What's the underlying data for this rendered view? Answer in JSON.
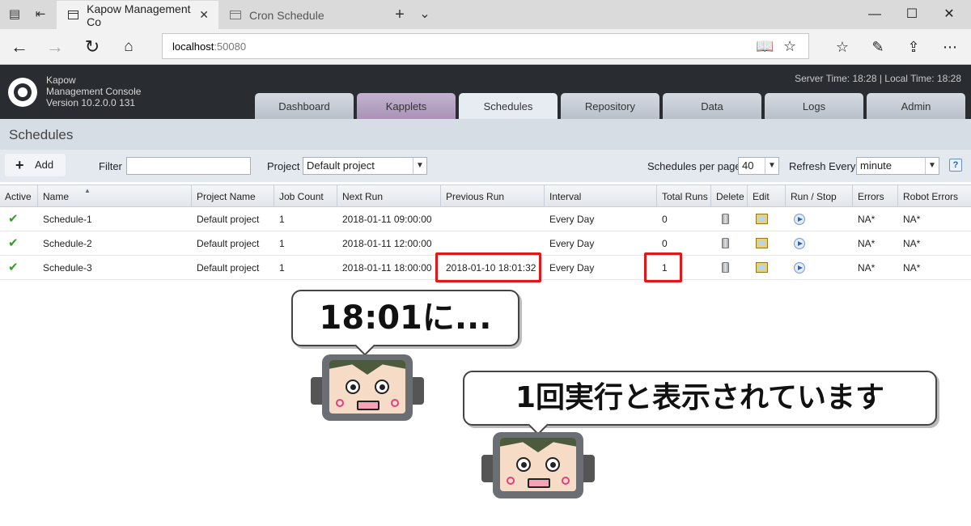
{
  "browser": {
    "tabs": [
      {
        "title": "Kapow Management Co",
        "active": true
      },
      {
        "title": "Cron Schedule",
        "active": false
      }
    ],
    "new_tab": "+",
    "tab_menu": "⌄",
    "url_host": "localhost",
    "url_port": ":50080"
  },
  "app": {
    "brand_line1": "Kapow",
    "brand_line2": "Management Console",
    "brand_line3": "Version 10.2.0.0 131",
    "server_time": "Server Time: 18:28  |  Local Time: 18:28",
    "tabs": [
      "Dashboard",
      "Kapplets",
      "Schedules",
      "Repository",
      "Data",
      "Logs",
      "Admin"
    ],
    "active_tab": "Schedules"
  },
  "schedules": {
    "title": "Schedules",
    "add_label": "Add",
    "filter_label": "Filter",
    "filter_value": "",
    "project_label": "Project",
    "project_value": "Default project",
    "per_page_label": "Schedules per page",
    "per_page_value": "40",
    "refresh_label": "Refresh Every",
    "refresh_value": "minute",
    "help": "?",
    "columns": [
      "Active",
      "Name",
      "Project Name",
      "Job Count",
      "Next Run",
      "Previous Run",
      "Interval",
      "Total Runs",
      "Delete",
      "Edit",
      "Run / Stop",
      "Errors",
      "Robot Errors"
    ],
    "rows": [
      {
        "name": "Schedule-1",
        "project": "Default project",
        "job_count": "1",
        "next_run": "2018-01-11 09:00:00",
        "previous_run": "",
        "interval": "Every Day",
        "total_runs": "0",
        "errors": "NA*",
        "robot_errors": "NA*"
      },
      {
        "name": "Schedule-2",
        "project": "Default project",
        "job_count": "1",
        "next_run": "2018-01-11 12:00:00",
        "previous_run": "",
        "interval": "Every Day",
        "total_runs": "0",
        "errors": "NA*",
        "robot_errors": "NA*"
      },
      {
        "name": "Schedule-3",
        "project": "Default project",
        "job_count": "1",
        "next_run": "2018-01-11 18:00:00",
        "previous_run": "2018-01-10 18:01:32",
        "interval": "Every Day",
        "total_runs": "1",
        "errors": "NA*",
        "robot_errors": "NA*"
      }
    ]
  },
  "annotations": {
    "bubble1": "18:01に...",
    "bubble2": "1回実行と表示されています"
  },
  "colors": {
    "header_bg": "#292c31",
    "highlight": "#e01818",
    "check": "#3a9b2e"
  }
}
